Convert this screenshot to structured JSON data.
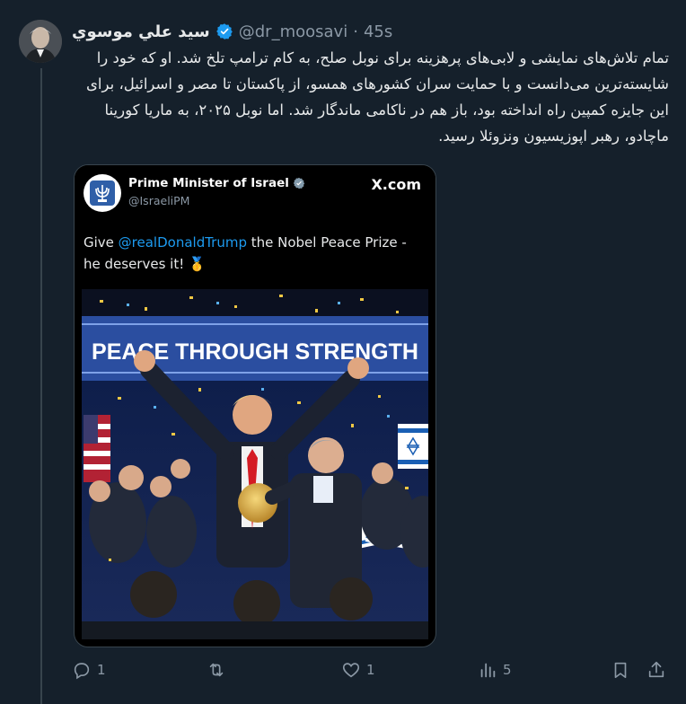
{
  "post": {
    "author_name": "سيد علي موسوي",
    "handle": "@dr_moosavi",
    "separator": "·",
    "time": "45s",
    "text": "تمام تلاش‌های نمایشی و لابی‌های پرهزینه برای نوبل صلح، به کام ترامپ تلخ شد. او که خود را شایسته‌ترین می‌دانست و با حمایت سران کشورهای همسو، از پاکستان تا مصر و اسرائیل، برای این جایزه کمپین راه انداخته بود، باز هم در ناکامی ماندگار شد. اما نوبل ۲۰۲۵، به ماریا کورینا ماچادو، رهبر اپوزیسیون ونزوئلا رسید."
  },
  "quoted": {
    "name": "Prime Minister of Israel",
    "handle": "@IsraeliPM",
    "brand": "X.com",
    "text_before": "Give ",
    "mention": "@realDonaldTrump",
    "text_after": " the Nobel Peace Prize - he deserves it! 🥇",
    "banner": "PEACE THROUGH STRENGTH"
  },
  "actions": {
    "replies": "1",
    "retweets": "",
    "likes": "1",
    "views": "5"
  },
  "colors": {
    "background": "#15202b",
    "text": "#e7e9ea",
    "muted": "#8b98a5",
    "accent": "#1d9bf0"
  }
}
